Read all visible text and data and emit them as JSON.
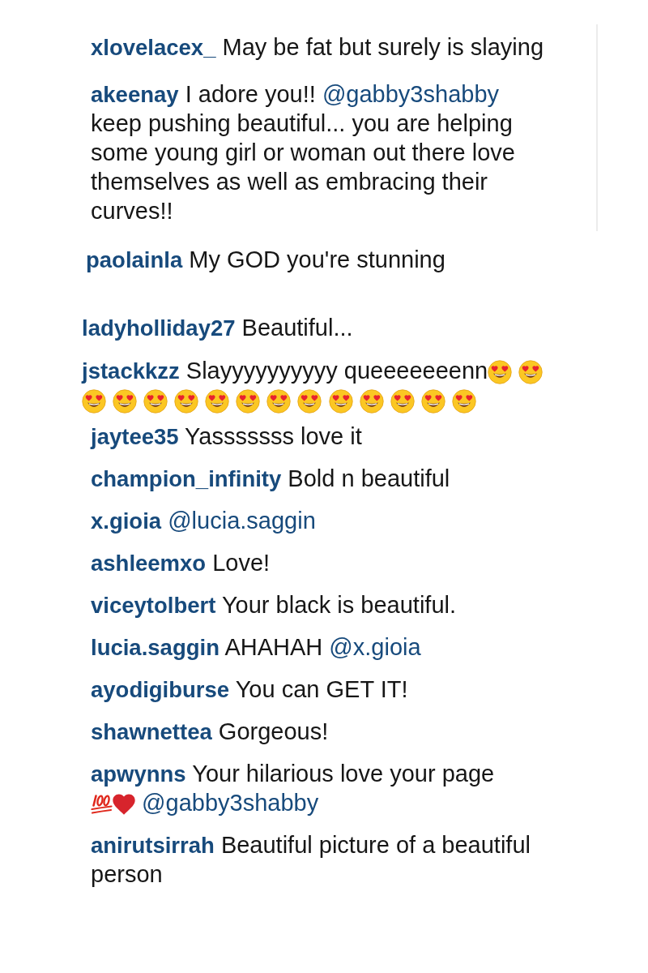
{
  "comment_blocks": [
    {
      "comments": [
        {
          "user": "xlovelacex_",
          "parts": [
            {
              "kind": "text",
              "text": "May be fat but surely is slaying"
            }
          ]
        },
        {
          "user": "akeenay",
          "parts": [
            {
              "kind": "text",
              "text": "I adore you!!"
            },
            {
              "kind": "mention",
              "text": "@gabby3shabby"
            },
            {
              "kind": "text",
              "text": "keep pushing beautiful... you are helping some young girl or woman out there love themselves as well as embracing their curves!!"
            }
          ]
        }
      ]
    },
    {
      "comments": [
        {
          "user": "paolainla",
          "parts": [
            {
              "kind": "text",
              "text": "My GOD you're stunning"
            }
          ]
        }
      ]
    },
    {
      "comments": [
        {
          "user": "ladyholliday27",
          "parts": [
            {
              "kind": "text",
              "text": "Beautiful..."
            }
          ]
        },
        {
          "user": "jstackkzz",
          "parts": [
            {
              "kind": "text",
              "text": "Slayyyyyyyyyy queeeeeeenn"
            },
            {
              "kind": "heart_eyes"
            },
            {
              "kind": "space"
            },
            {
              "kind": "heart_eyes"
            },
            {
              "kind": "space"
            },
            {
              "kind": "heart_eyes"
            },
            {
              "kind": "space"
            },
            {
              "kind": "heart_eyes"
            },
            {
              "kind": "space"
            },
            {
              "kind": "heart_eyes"
            },
            {
              "kind": "space"
            },
            {
              "kind": "heart_eyes"
            },
            {
              "kind": "space"
            },
            {
              "kind": "heart_eyes"
            },
            {
              "kind": "space"
            },
            {
              "kind": "heart_eyes"
            },
            {
              "kind": "space"
            },
            {
              "kind": "heart_eyes"
            },
            {
              "kind": "space"
            },
            {
              "kind": "heart_eyes"
            },
            {
              "kind": "space"
            },
            {
              "kind": "heart_eyes"
            },
            {
              "kind": "space"
            },
            {
              "kind": "heart_eyes"
            },
            {
              "kind": "space"
            },
            {
              "kind": "heart_eyes"
            },
            {
              "kind": "space"
            },
            {
              "kind": "heart_eyes"
            },
            {
              "kind": "space"
            },
            {
              "kind": "heart_eyes"
            }
          ]
        }
      ]
    },
    {
      "comments": [
        {
          "user": "jaytee35",
          "parts": [
            {
              "kind": "text",
              "text": "Yasssssss love it"
            }
          ]
        },
        {
          "user": "champion_infinity",
          "parts": [
            {
              "kind": "text",
              "text": "Bold n beautiful"
            }
          ]
        },
        {
          "user": "x.gioia",
          "parts": [
            {
              "kind": "mention",
              "text": "@lucia.saggin"
            }
          ]
        },
        {
          "user": "ashleemxo",
          "parts": [
            {
              "kind": "text",
              "text": "Love!"
            }
          ]
        },
        {
          "user": "viceytolbert",
          "parts": [
            {
              "kind": "text",
              "text": "Your black is beautiful."
            }
          ]
        },
        {
          "user": "lucia.saggin",
          "parts": [
            {
              "kind": "text",
              "text": "AHAHAH"
            },
            {
              "kind": "mention",
              "text": "@x.gioia"
            }
          ]
        },
        {
          "user": "ayodigiburse",
          "parts": [
            {
              "kind": "text",
              "text": "You can GET IT!"
            }
          ]
        },
        {
          "user": "shawnettea",
          "parts": [
            {
              "kind": "text",
              "text": "Gorgeous!"
            }
          ]
        },
        {
          "user": "apwynns",
          "parts": [
            {
              "kind": "text",
              "text": "Your hilarious love your page"
            },
            {
              "kind": "space"
            },
            {
              "kind": "hundred"
            },
            {
              "kind": "heart"
            },
            {
              "kind": "mention",
              "text": "@gabby3shabby"
            }
          ]
        },
        {
          "user": "anirutsirrah",
          "parts": [
            {
              "kind": "text",
              "text": "Beautiful picture of a beautiful person"
            }
          ]
        }
      ]
    }
  ]
}
